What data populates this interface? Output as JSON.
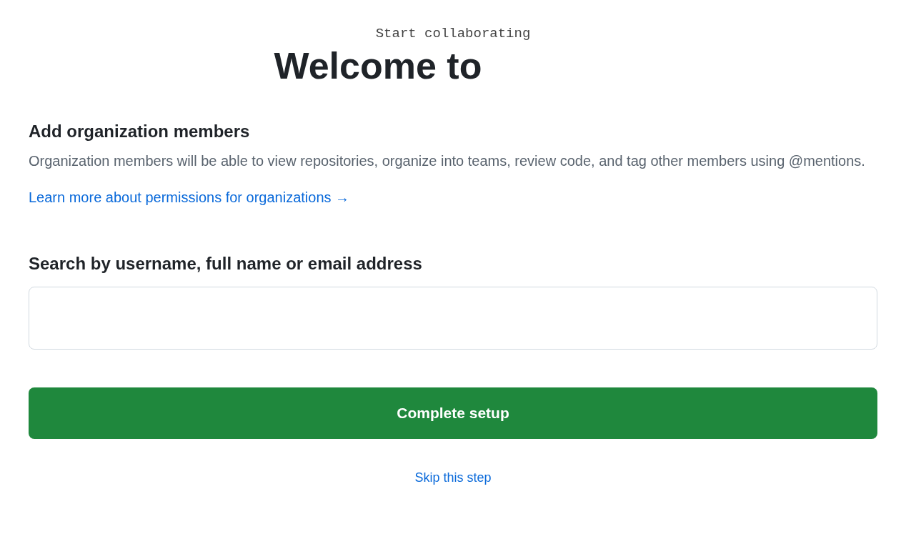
{
  "eyebrow": "Start collaborating",
  "title": "Welcome to",
  "section": {
    "heading": "Add organization members",
    "description": "Organization members will be able to view repositories, organize into teams, review code, and tag other members using @mentions.",
    "link": "Learn more about permissions for organizations →"
  },
  "search": {
    "label": "Search by username, full name or email address"
  },
  "buttons": {
    "primary": "Complete setup",
    "skip": "Skip this step"
  }
}
